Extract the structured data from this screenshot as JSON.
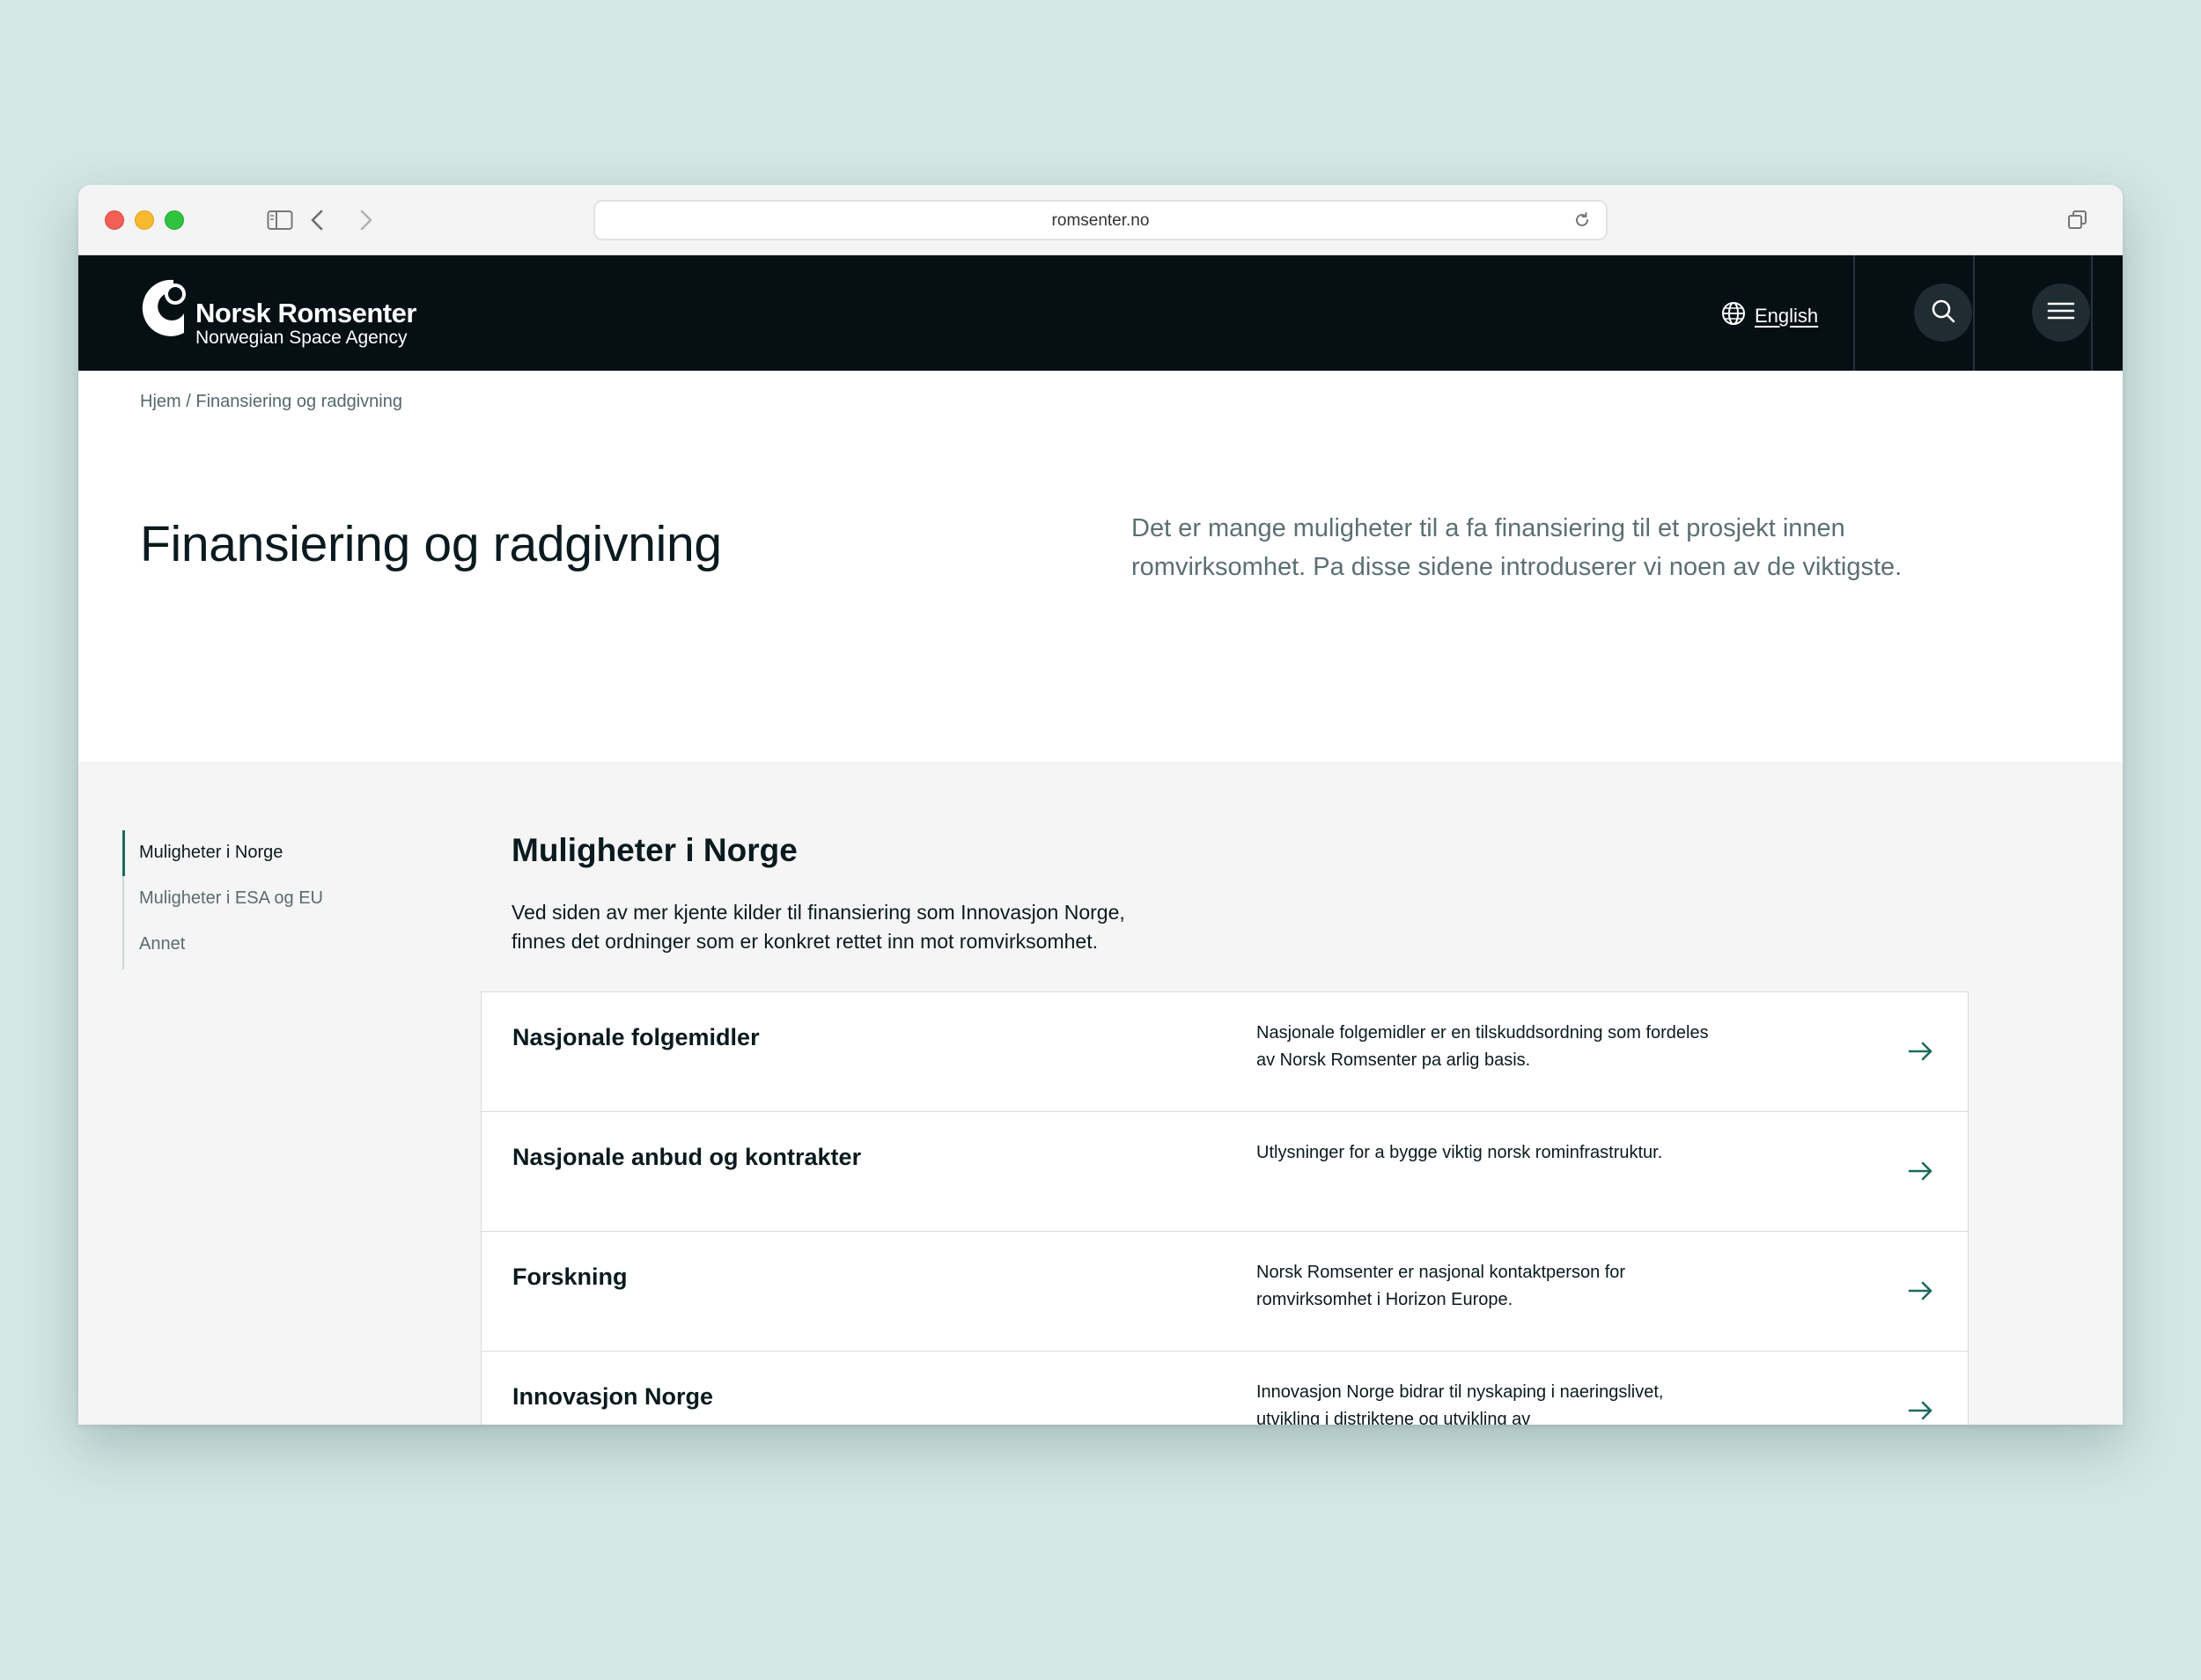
{
  "browser": {
    "url": "romsenter.no"
  },
  "header": {
    "logo_name": "Norsk Romsenter",
    "logo_subtitle": "Norwegian Space Agency",
    "language_label": "English",
    "icons": [
      "globe-icon",
      "search-icon",
      "hamburger-menu-icon"
    ]
  },
  "breadcrumb": {
    "home": "Hjem",
    "separator": "/",
    "current": "Finansiering og radgivning"
  },
  "hero": {
    "title": "Finansiering og radgivning",
    "intro": "Det er mange muligheter til a fa finansiering til et prosjekt innen romvirksomhet. Pa disse sidene introduserer vi noen av de viktigste."
  },
  "sidenav": {
    "items": [
      {
        "label": "Muligheter i Norge",
        "active": true
      },
      {
        "label": "Muligheter i ESA og EU",
        "active": false
      },
      {
        "label": "Annet",
        "active": false
      }
    ]
  },
  "section": {
    "title": "Muligheter i Norge",
    "description": "Ved siden av mer kjente kilder til finansiering som Innovasjon Norge, finnes det ordninger som er konkret rettet inn mot romvirksomhet."
  },
  "cards": [
    {
      "title": "Nasjonale folgemidler",
      "description": "Nasjonale folgemidler er en tilskuddsordning som fordeles av Norsk Romsenter pa arlig basis."
    },
    {
      "title": "Nasjonale anbud og kontrakter",
      "description": "Utlysninger for a bygge viktig norsk rominfrastruktur."
    },
    {
      "title": "Forskning",
      "description": "Norsk Romsenter er nasjonal kontaktperson for romvirksomhet i Horizon Europe."
    },
    {
      "title": "Innovasjon Norge",
      "description": "Innovasjon Norge bidrar til nyskaping i naeringslivet, utvikling i distriktene og utvikling av"
    }
  ],
  "colors": {
    "page_background": "#d3e7e4",
    "header_background": "#050f14",
    "accent": "#1e6a5c",
    "content_background": "#f5f5f5"
  }
}
